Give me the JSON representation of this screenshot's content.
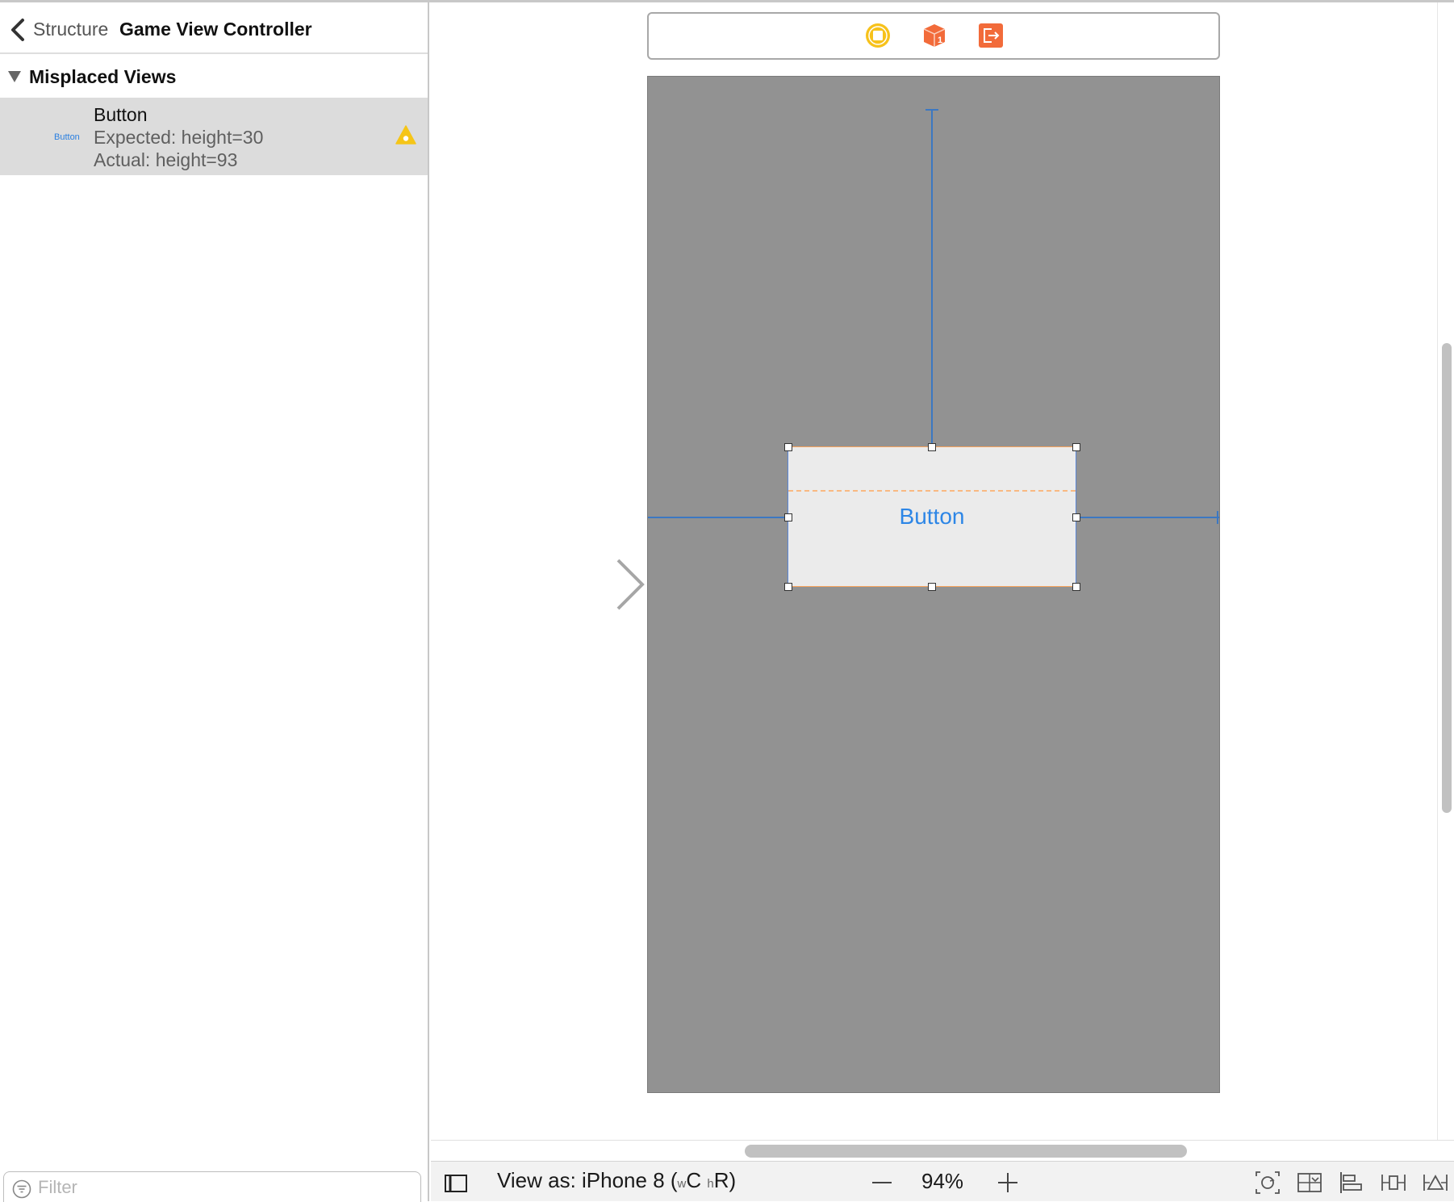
{
  "outline": {
    "breadcrumb_parent": "Structure",
    "breadcrumb_title": "Game View Controller",
    "group_label": "Misplaced Views",
    "issue": {
      "thumbnail_label": "Button",
      "title": "Button",
      "expected": "Expected: height=30",
      "actual": "Actual: height=93"
    },
    "filter_placeholder": "Filter"
  },
  "canvas": {
    "button_label": "Button",
    "view_background": "#929292",
    "constraint_color": "#3c78c2"
  },
  "bottom_bar": {
    "view_as_prefix": "View as: iPhone 8 (",
    "size_class_w_sub": "w",
    "size_class_w": "C ",
    "size_class_h_sub": "h",
    "size_class_h": "R)",
    "zoom_level": "94%"
  },
  "colors": {
    "accent_blue": "#2d86e6",
    "warning_yellow": "#f5c518",
    "dock_orange": "#f26b3a",
    "dock_yellow": "#f7c21b"
  },
  "icons": {
    "back": "chevron-left-icon",
    "disclosure": "triangle-down-icon",
    "warning": "warning-triangle-icon",
    "filter": "filter-icon",
    "view_controller": "view-controller-icon",
    "first_responder": "first-responder-cube-icon",
    "exit": "exit-icon",
    "toggle_outline": "document-outline-icon",
    "zoom_out": "minus-icon",
    "zoom_in": "plus-icon",
    "embed": "embed-in-icon",
    "update_frames": "update-frames-icon",
    "align": "align-icon",
    "pin": "add-constraints-icon",
    "resolve": "resolve-issues-icon"
  }
}
